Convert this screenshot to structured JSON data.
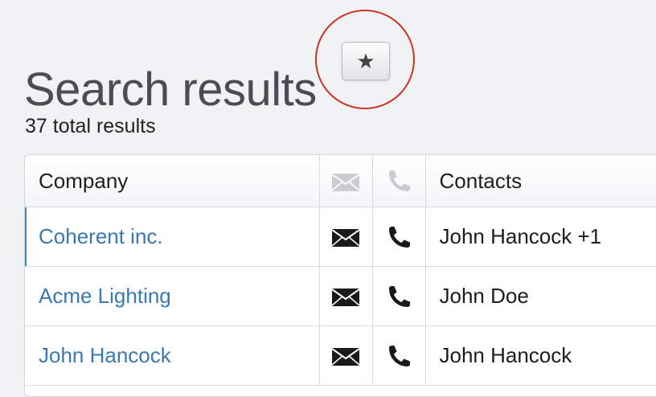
{
  "header": {
    "title": "Search results",
    "star_glyph": "★",
    "result_count": "37 total results"
  },
  "table": {
    "columns": {
      "company": "Company",
      "email": "mail-icon",
      "phone": "phone-icon",
      "contacts": "Contacts"
    },
    "rows": [
      {
        "company": "Coherent inc.",
        "contacts": "John Hancock +1",
        "selected": true
      },
      {
        "company": "Acme Lighting",
        "contacts": "John Doe",
        "selected": false
      },
      {
        "company": "John Hancock",
        "contacts": "John Hancock",
        "selected": false
      }
    ]
  },
  "colors": {
    "link": "#3a78b4",
    "highlight_circle": "#cc3322",
    "header_icon": "#c9ccd1",
    "row_icon": "#1a1a1a"
  }
}
